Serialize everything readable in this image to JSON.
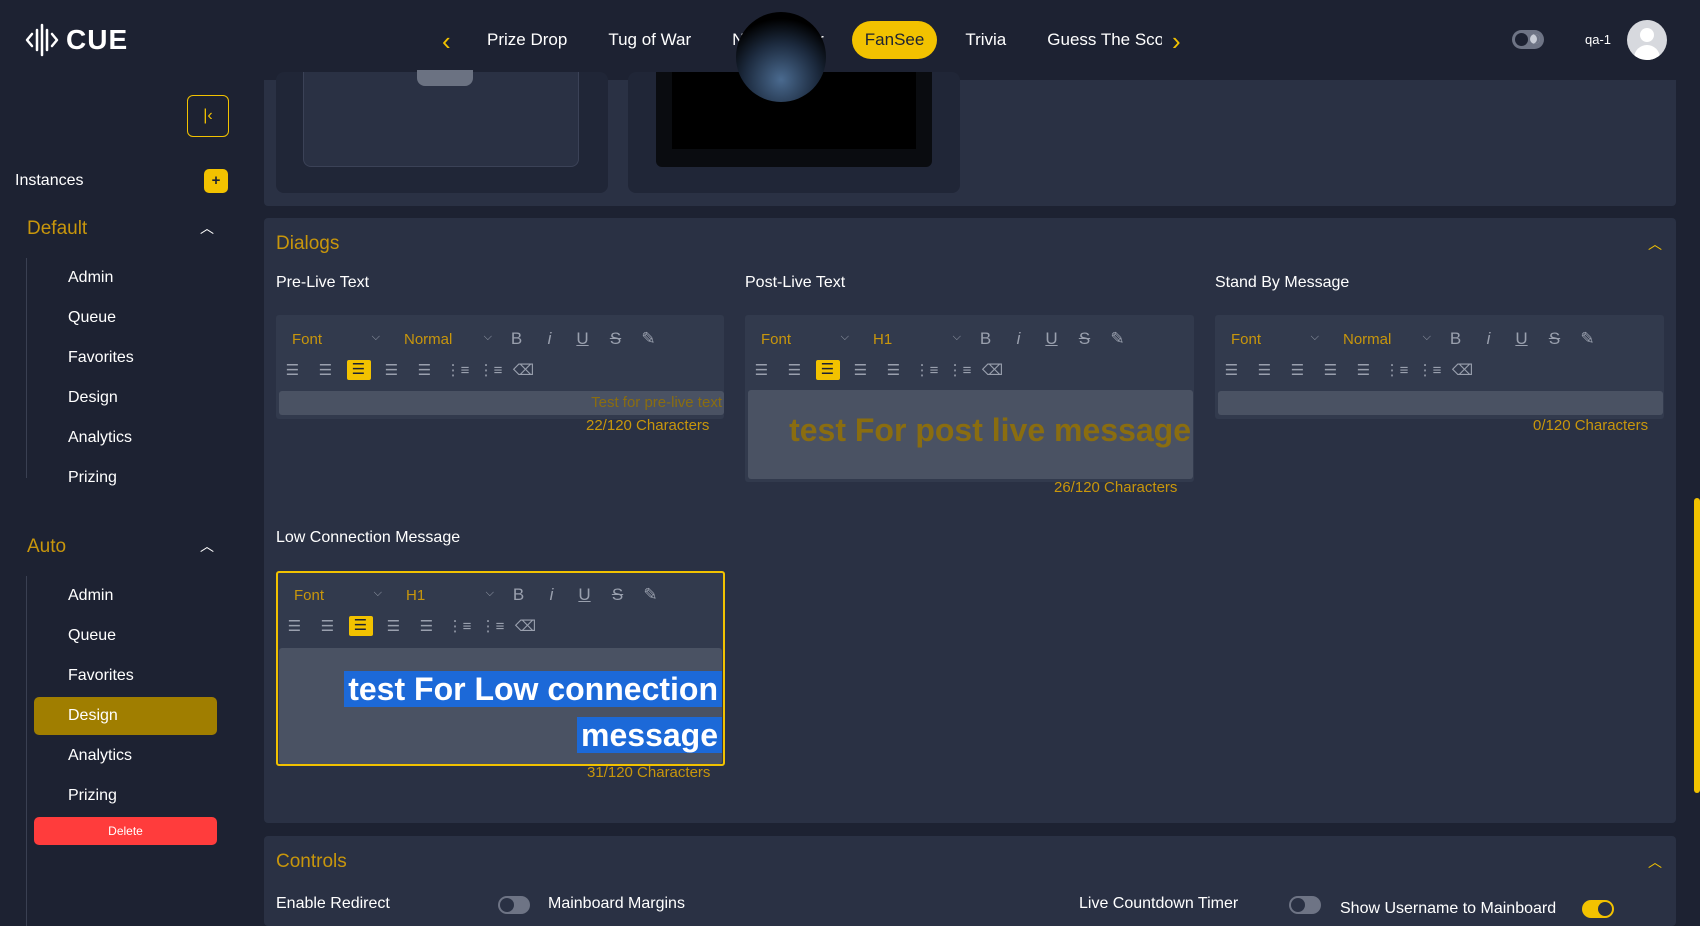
{
  "app": {
    "logo_text": "CUE"
  },
  "nav": {
    "tabs": [
      "Prize Drop",
      "Tug of War",
      "Noise Meter",
      "FanSee",
      "Trivia",
      "Guess The Score"
    ],
    "active_tab": "FanSee"
  },
  "user": {
    "name": "qa-1"
  },
  "sidebar": {
    "instances_label": "Instances",
    "add_label": "+",
    "groups": [
      {
        "title": "Default",
        "items": [
          "Admin",
          "Queue",
          "Favorites",
          "Design",
          "Analytics",
          "Prizing"
        ]
      },
      {
        "title": "Auto",
        "items": [
          "Admin",
          "Queue",
          "Favorites",
          "Design",
          "Analytics",
          "Prizing"
        ],
        "active_item": "Design"
      }
    ],
    "delete_label": "Delete"
  },
  "dialogs": {
    "title": "Dialogs",
    "editors": [
      {
        "label": "Pre-Live Text",
        "font": "Font",
        "size": "Normal",
        "text": "Test for pre-live text",
        "count": "22/120 Characters"
      },
      {
        "label": "Post-Live Text",
        "font": "Font",
        "size": "H1",
        "text": "test For post live message",
        "count": "26/120 Characters"
      },
      {
        "label": "Stand By Message",
        "font": "Font",
        "size": "Normal",
        "text": "",
        "count": "0/120 Characters"
      },
      {
        "label": "Low Connection Message",
        "font": "Font",
        "size": "H1",
        "text_line1": "test For Low connection",
        "text_line2": "message",
        "count": "31/120 Characters"
      }
    ]
  },
  "controls": {
    "title": "Controls",
    "items": [
      {
        "label": "Enable Redirect",
        "on": false
      },
      {
        "label": "Mainboard Margins"
      },
      {
        "label": "Live Countdown Timer",
        "on": false
      },
      {
        "label": "Show Username to Mainboard",
        "on": true
      }
    ]
  },
  "colors": {
    "accent": "#f2c200",
    "background": "#1d2232",
    "panel": "#2a3144",
    "danger": "#ff3c3c",
    "selection": "#1c69d8"
  }
}
